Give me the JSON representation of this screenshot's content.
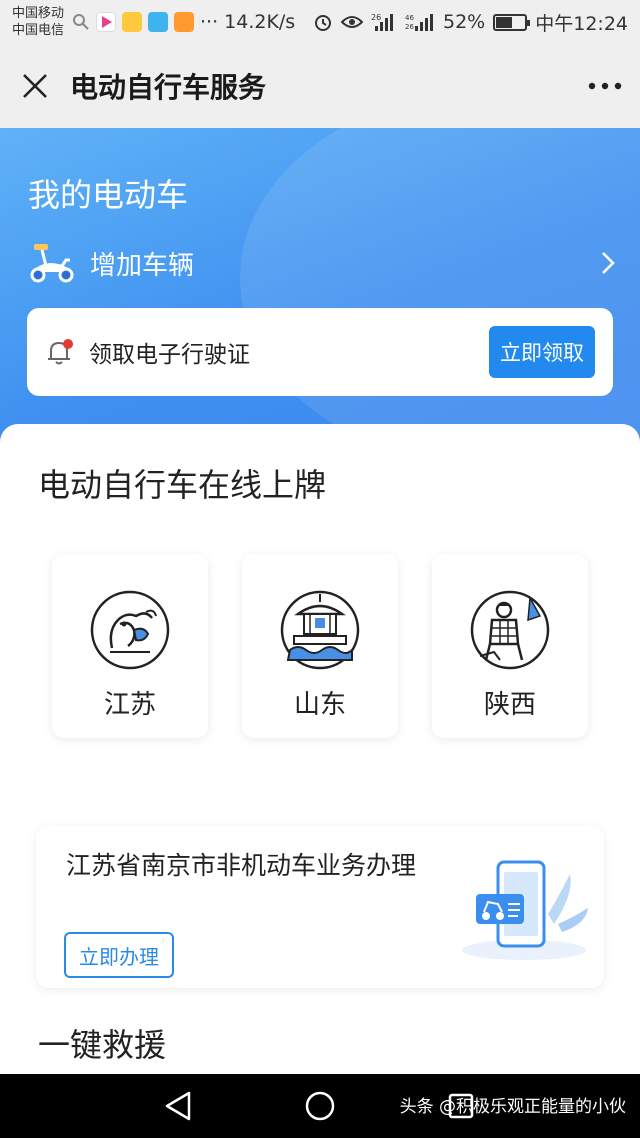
{
  "status_bar": {
    "carrier1": "中国移动",
    "carrier2": "中国电信",
    "more": "···",
    "speed": "14.2K/s",
    "signal1_tag": "26",
    "signal2_tag": "46 26",
    "battery": "52%",
    "time": "中午12:24"
  },
  "header": {
    "title": "电动自行车服务",
    "close_icon": "close-icon",
    "more_icon": "more-dots-icon"
  },
  "hero": {
    "title": "我的电动车",
    "add_vehicle": "增加车辆",
    "license_text": "领取电子行驶证",
    "license_button": "立即领取"
  },
  "plate_section": {
    "title": "电动自行车在线上牌",
    "provinces": [
      {
        "name": "江苏",
        "icon": "jiangsu-dragon-icon"
      },
      {
        "name": "山东",
        "icon": "shandong-pavilion-icon"
      },
      {
        "name": "陕西",
        "icon": "shaanxi-terracotta-icon"
      }
    ]
  },
  "service": {
    "title": "江苏省南京市非机动车业务办理",
    "button": "立即办理"
  },
  "rescue": {
    "title": "一键救援"
  },
  "watermark": "头条 @积极乐观正能量的小伙",
  "colors": {
    "accent": "#2289ef",
    "hero_top": "#5fb2f7",
    "hero_bottom": "#3a86ee",
    "notify_red": "#e53935"
  }
}
